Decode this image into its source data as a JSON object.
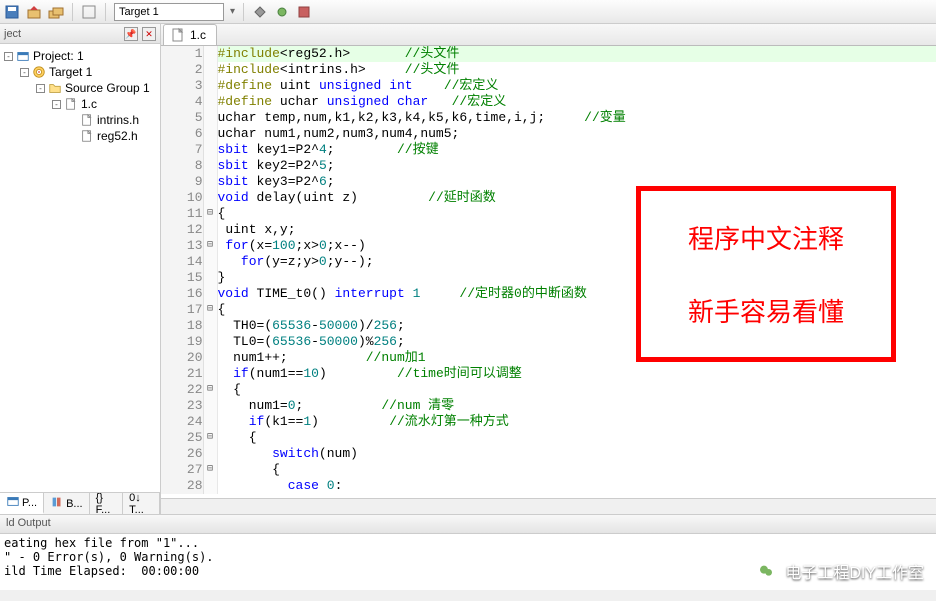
{
  "toolbar": {
    "target_label": "Target 1"
  },
  "sidebar": {
    "title": "ject",
    "tree": [
      {
        "indent": 0,
        "exp": "-",
        "icon": "proj",
        "label": "Project: 1"
      },
      {
        "indent": 1,
        "exp": "-",
        "icon": "target",
        "label": "Target 1"
      },
      {
        "indent": 2,
        "exp": "-",
        "icon": "folder",
        "label": "Source Group 1"
      },
      {
        "indent": 3,
        "exp": "-",
        "icon": "file",
        "label": "1.c"
      },
      {
        "indent": 4,
        "exp": "",
        "icon": "file",
        "label": "intrins.h"
      },
      {
        "indent": 4,
        "exp": "",
        "icon": "file",
        "label": "reg52.h"
      }
    ],
    "tabs": [
      {
        "label": "P...",
        "icon": "proj",
        "active": true
      },
      {
        "label": "B...",
        "icon": "books"
      },
      {
        "label": "{} F..."
      },
      {
        "label": "0↓ T..."
      }
    ]
  },
  "file_tab": {
    "name": "1.c"
  },
  "code_lines": [
    {
      "n": 1,
      "fold": "",
      "hl": true,
      "html": "<span class='tok-pp'>#include</span><span class='tok-id'>&lt;reg52.h&gt;</span>       <span class='tok-cmt'>//头文件</span>"
    },
    {
      "n": 2,
      "fold": "",
      "html": "<span class='tok-pp'>#include</span><span class='tok-id'>&lt;intrins.h&gt;</span>     <span class='tok-cmt'>//头文件</span>"
    },
    {
      "n": 3,
      "fold": "",
      "html": "<span class='tok-pp'>#define</span> <span class='tok-id'>uint</span> <span class='tok-kw'>unsigned</span> <span class='tok-kw'>int</span>    <span class='tok-cmt'>//宏定义</span>"
    },
    {
      "n": 4,
      "fold": "",
      "html": "<span class='tok-pp'>#define</span> <span class='tok-id'>uchar</span> <span class='tok-kw'>unsigned</span> <span class='tok-kw'>char</span>   <span class='tok-cmt'>//宏定义</span>"
    },
    {
      "n": 5,
      "fold": "",
      "html": "<span class='tok-id'>uchar temp,num,k1,k2,k3,k4,k5,k6,time,i,j;</span>     <span class='tok-cmt'>//变量</span>"
    },
    {
      "n": 6,
      "fold": "",
      "html": "<span class='tok-id'>uchar num1,num2,num3,num4,num5;</span>"
    },
    {
      "n": 7,
      "fold": "",
      "html": "<span class='tok-kw'>sbit</span> <span class='tok-id'>key1=P2^</span><span class='tok-num'>4</span><span class='tok-id'>;</span>        <span class='tok-cmt'>//按键</span>"
    },
    {
      "n": 8,
      "fold": "",
      "html": "<span class='tok-kw'>sbit</span> <span class='tok-id'>key2=P2^</span><span class='tok-num'>5</span><span class='tok-id'>;</span>"
    },
    {
      "n": 9,
      "fold": "",
      "html": "<span class='tok-kw'>sbit</span> <span class='tok-id'>key3=P2^</span><span class='tok-num'>6</span><span class='tok-id'>;</span>"
    },
    {
      "n": 10,
      "fold": "",
      "html": "<span class='tok-kw'>void</span> <span class='tok-id'>delay(uint z)</span>         <span class='tok-cmt'>//延时函数</span>"
    },
    {
      "n": 11,
      "fold": "⊟",
      "html": "<span class='tok-id'>{</span>"
    },
    {
      "n": 12,
      "fold": "",
      "html": " <span class='tok-id'>uint x,y;</span>"
    },
    {
      "n": 13,
      "fold": "⊟",
      "html": " <span class='tok-kw'>for</span><span class='tok-id'>(x=</span><span class='tok-num'>100</span><span class='tok-id'>;x&gt;</span><span class='tok-num'>0</span><span class='tok-id'>;x--)</span>"
    },
    {
      "n": 14,
      "fold": "",
      "html": "   <span class='tok-kw'>for</span><span class='tok-id'>(y=z;y&gt;</span><span class='tok-num'>0</span><span class='tok-id'>;y--);</span>"
    },
    {
      "n": 15,
      "fold": "",
      "html": "<span class='tok-id'>}</span>"
    },
    {
      "n": 16,
      "fold": "",
      "html": "<span class='tok-kw'>void</span> <span class='tok-id'>TIME_t0()</span> <span class='tok-kw'>interrupt</span> <span class='tok-num'>1</span>     <span class='tok-cmt'>//定时器0的中断函数</span>"
    },
    {
      "n": 17,
      "fold": "⊟",
      "html": "<span class='tok-id'>{</span>"
    },
    {
      "n": 18,
      "fold": "",
      "html": "  <span class='tok-id'>TH0=(</span><span class='tok-num'>65536</span><span class='tok-id'>-</span><span class='tok-num'>50000</span><span class='tok-id'>)/</span><span class='tok-num'>256</span><span class='tok-id'>;</span>"
    },
    {
      "n": 19,
      "fold": "",
      "html": "  <span class='tok-id'>TL0=(</span><span class='tok-num'>65536</span><span class='tok-id'>-</span><span class='tok-num'>50000</span><span class='tok-id'>)%</span><span class='tok-num'>256</span><span class='tok-id'>;</span>"
    },
    {
      "n": 20,
      "fold": "",
      "html": "  <span class='tok-id'>num1++;</span>          <span class='tok-cmt'>//num加1</span>"
    },
    {
      "n": 21,
      "fold": "",
      "html": "  <span class='tok-kw'>if</span><span class='tok-id'>(num1==</span><span class='tok-num'>10</span><span class='tok-id'>)</span>         <span class='tok-cmt'>//time时间可以调整</span>"
    },
    {
      "n": 22,
      "fold": "⊟",
      "html": "  <span class='tok-id'>{</span>"
    },
    {
      "n": 23,
      "fold": "",
      "html": "    <span class='tok-id'>num1=</span><span class='tok-num'>0</span><span class='tok-id'>;</span>          <span class='tok-cmt'>//num 清零</span>"
    },
    {
      "n": 24,
      "fold": "",
      "html": "    <span class='tok-kw'>if</span><span class='tok-id'>(k1==</span><span class='tok-num'>1</span><span class='tok-id'>)</span>         <span class='tok-cmt'>//流水灯第一种方式</span>"
    },
    {
      "n": 25,
      "fold": "⊟",
      "html": "    <span class='tok-id'>{</span>"
    },
    {
      "n": 26,
      "fold": "",
      "html": "       <span class='tok-kw'>switch</span><span class='tok-id'>(num)</span>"
    },
    {
      "n": 27,
      "fold": "⊟",
      "html": "       <span class='tok-id'>{</span>"
    },
    {
      "n": 28,
      "fold": "",
      "html": "         <span class='tok-kw'>case</span> <span class='tok-num'>0</span><span class='tok-id'>:</span>"
    }
  ],
  "output": {
    "title": "ld Output",
    "lines": [
      "eating hex file from \"1\"...",
      "\" - 0 Error(s), 0 Warning(s).",
      "ild Time Elapsed:  00:00:00"
    ]
  },
  "annotation": {
    "line1": "程序中文注释",
    "line2": "新手容易看懂"
  },
  "watermark": "电子工程DIY工作室"
}
